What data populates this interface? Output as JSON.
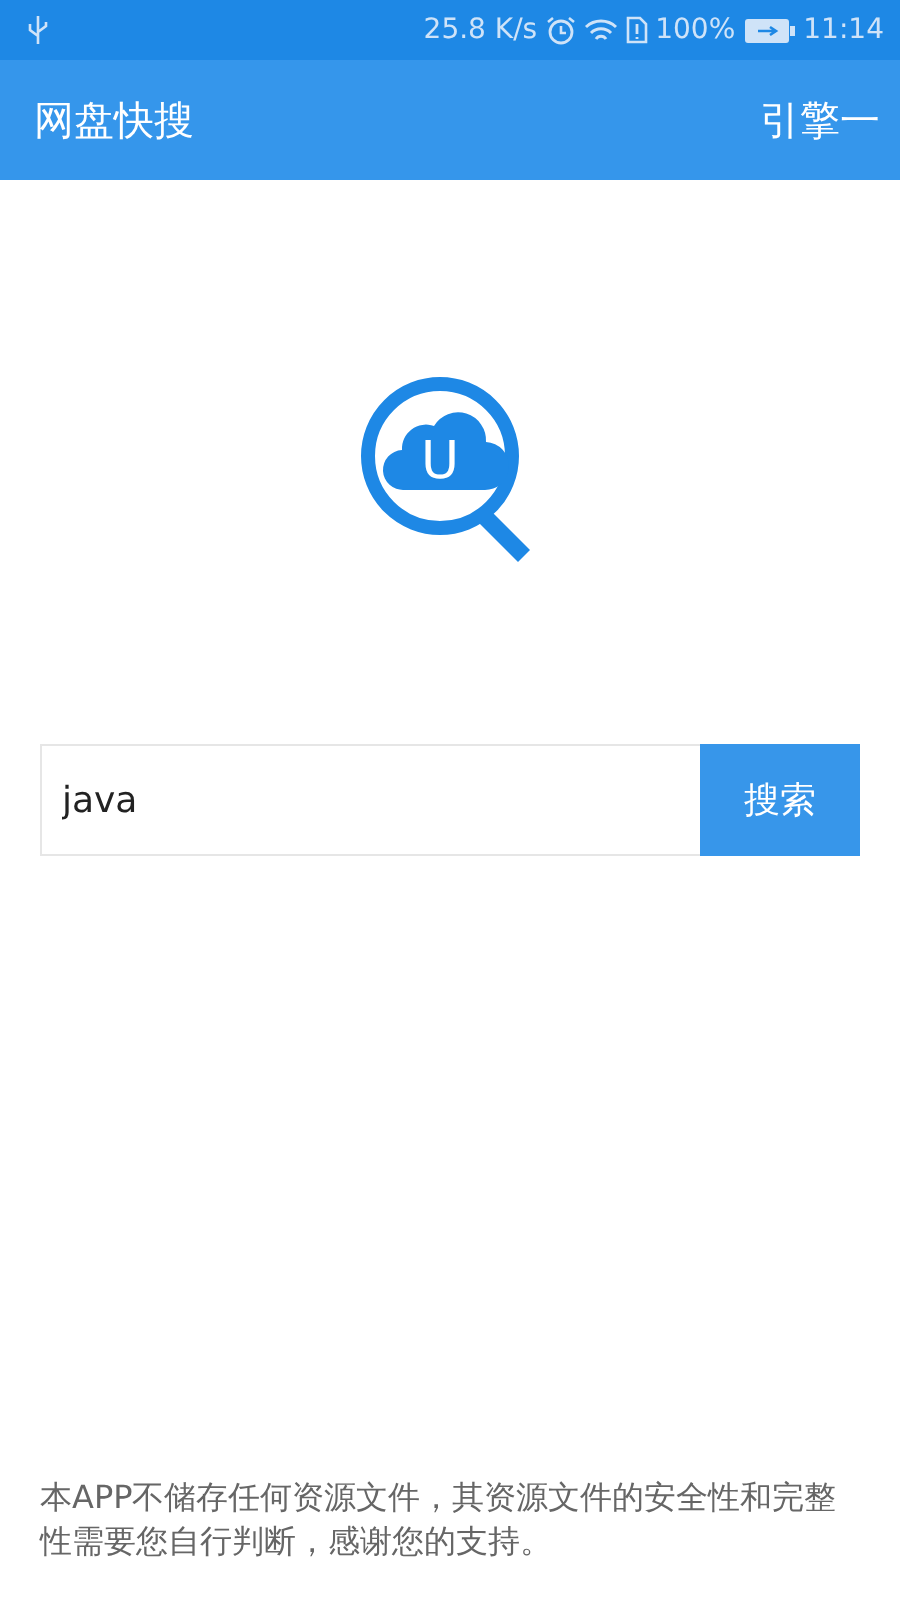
{
  "status_bar": {
    "speed": "25.8 K/s",
    "battery": "100%",
    "time": "11:14"
  },
  "app_bar": {
    "title": "网盘快搜",
    "action": "引擎一"
  },
  "logo": {
    "letter": "U"
  },
  "search": {
    "value": "java",
    "button": "搜索"
  },
  "footer": {
    "notice": "本APP不储存任何资源文件，其资源文件的安全性和完整性需要您自行判断，感谢您的支持。"
  }
}
